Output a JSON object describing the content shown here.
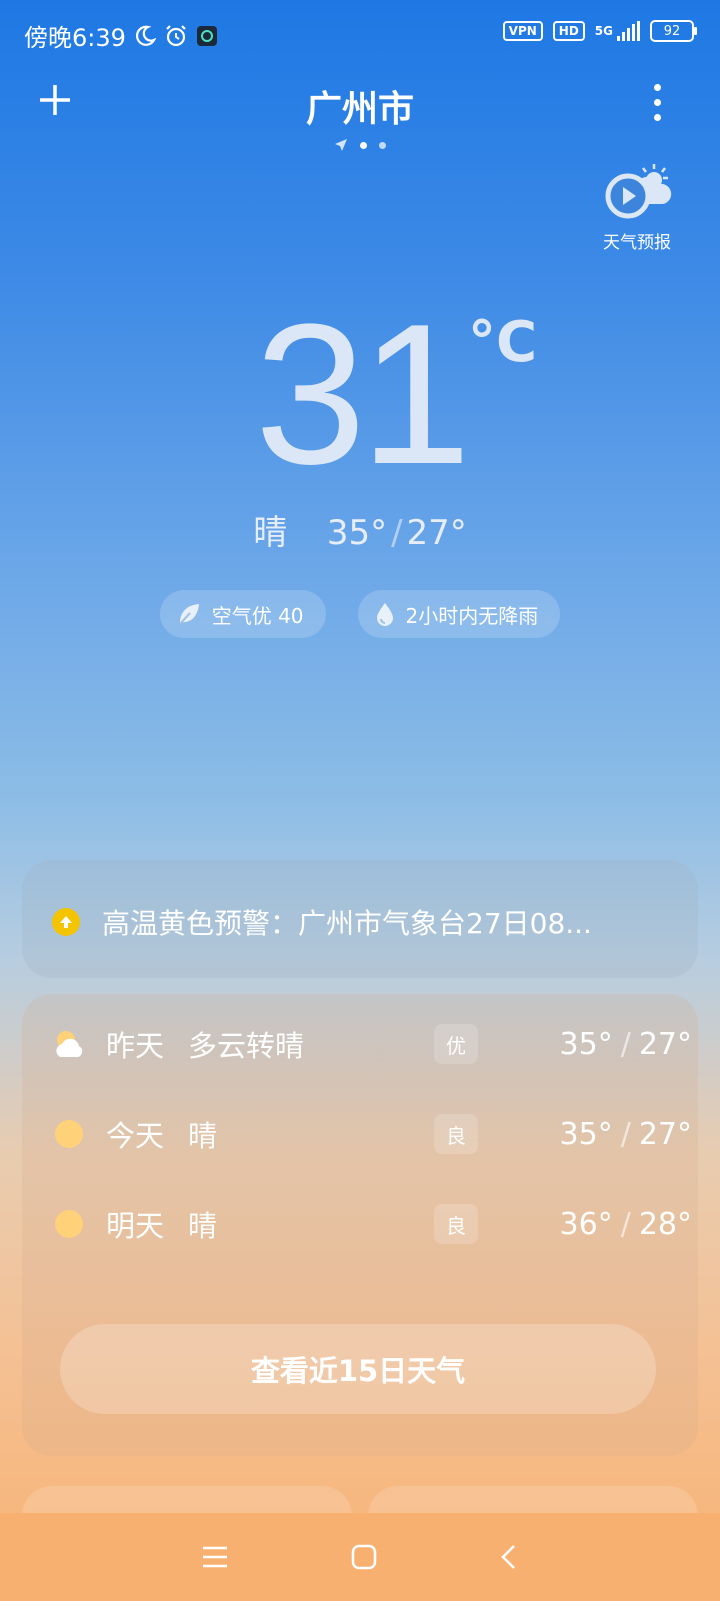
{
  "status": {
    "time": "傍晚6:39",
    "vpn": "VPN",
    "hd": "HD",
    "network": "5G",
    "battery": "92"
  },
  "header": {
    "city": "广州市",
    "forecast_video_label": "天气预报"
  },
  "current": {
    "temperature": "31",
    "unit": "°C",
    "condition": "晴",
    "high": "35°",
    "low": "27°",
    "air_quality": "空气优 40",
    "rain": "2小时内无降雨"
  },
  "alert": {
    "text": "高温黄色预警：广州市气象台27日08..."
  },
  "daily": [
    {
      "name": "昨天",
      "desc": "多云转晴",
      "aqi": "优",
      "high": "35°",
      "low": "27°",
      "icon": "partly-cloudy-icon"
    },
    {
      "name": "今天",
      "desc": "晴",
      "aqi": "良",
      "high": "35°",
      "low": "27°",
      "icon": "sun-icon"
    },
    {
      "name": "明天",
      "desc": "晴",
      "aqi": "良",
      "high": "36°",
      "low": "28°",
      "icon": "sun-icon"
    }
  ],
  "button_15day": "查看近15日天气",
  "colors": {
    "alert_yellow": "#f5c400",
    "sun": "#ffd27a"
  }
}
